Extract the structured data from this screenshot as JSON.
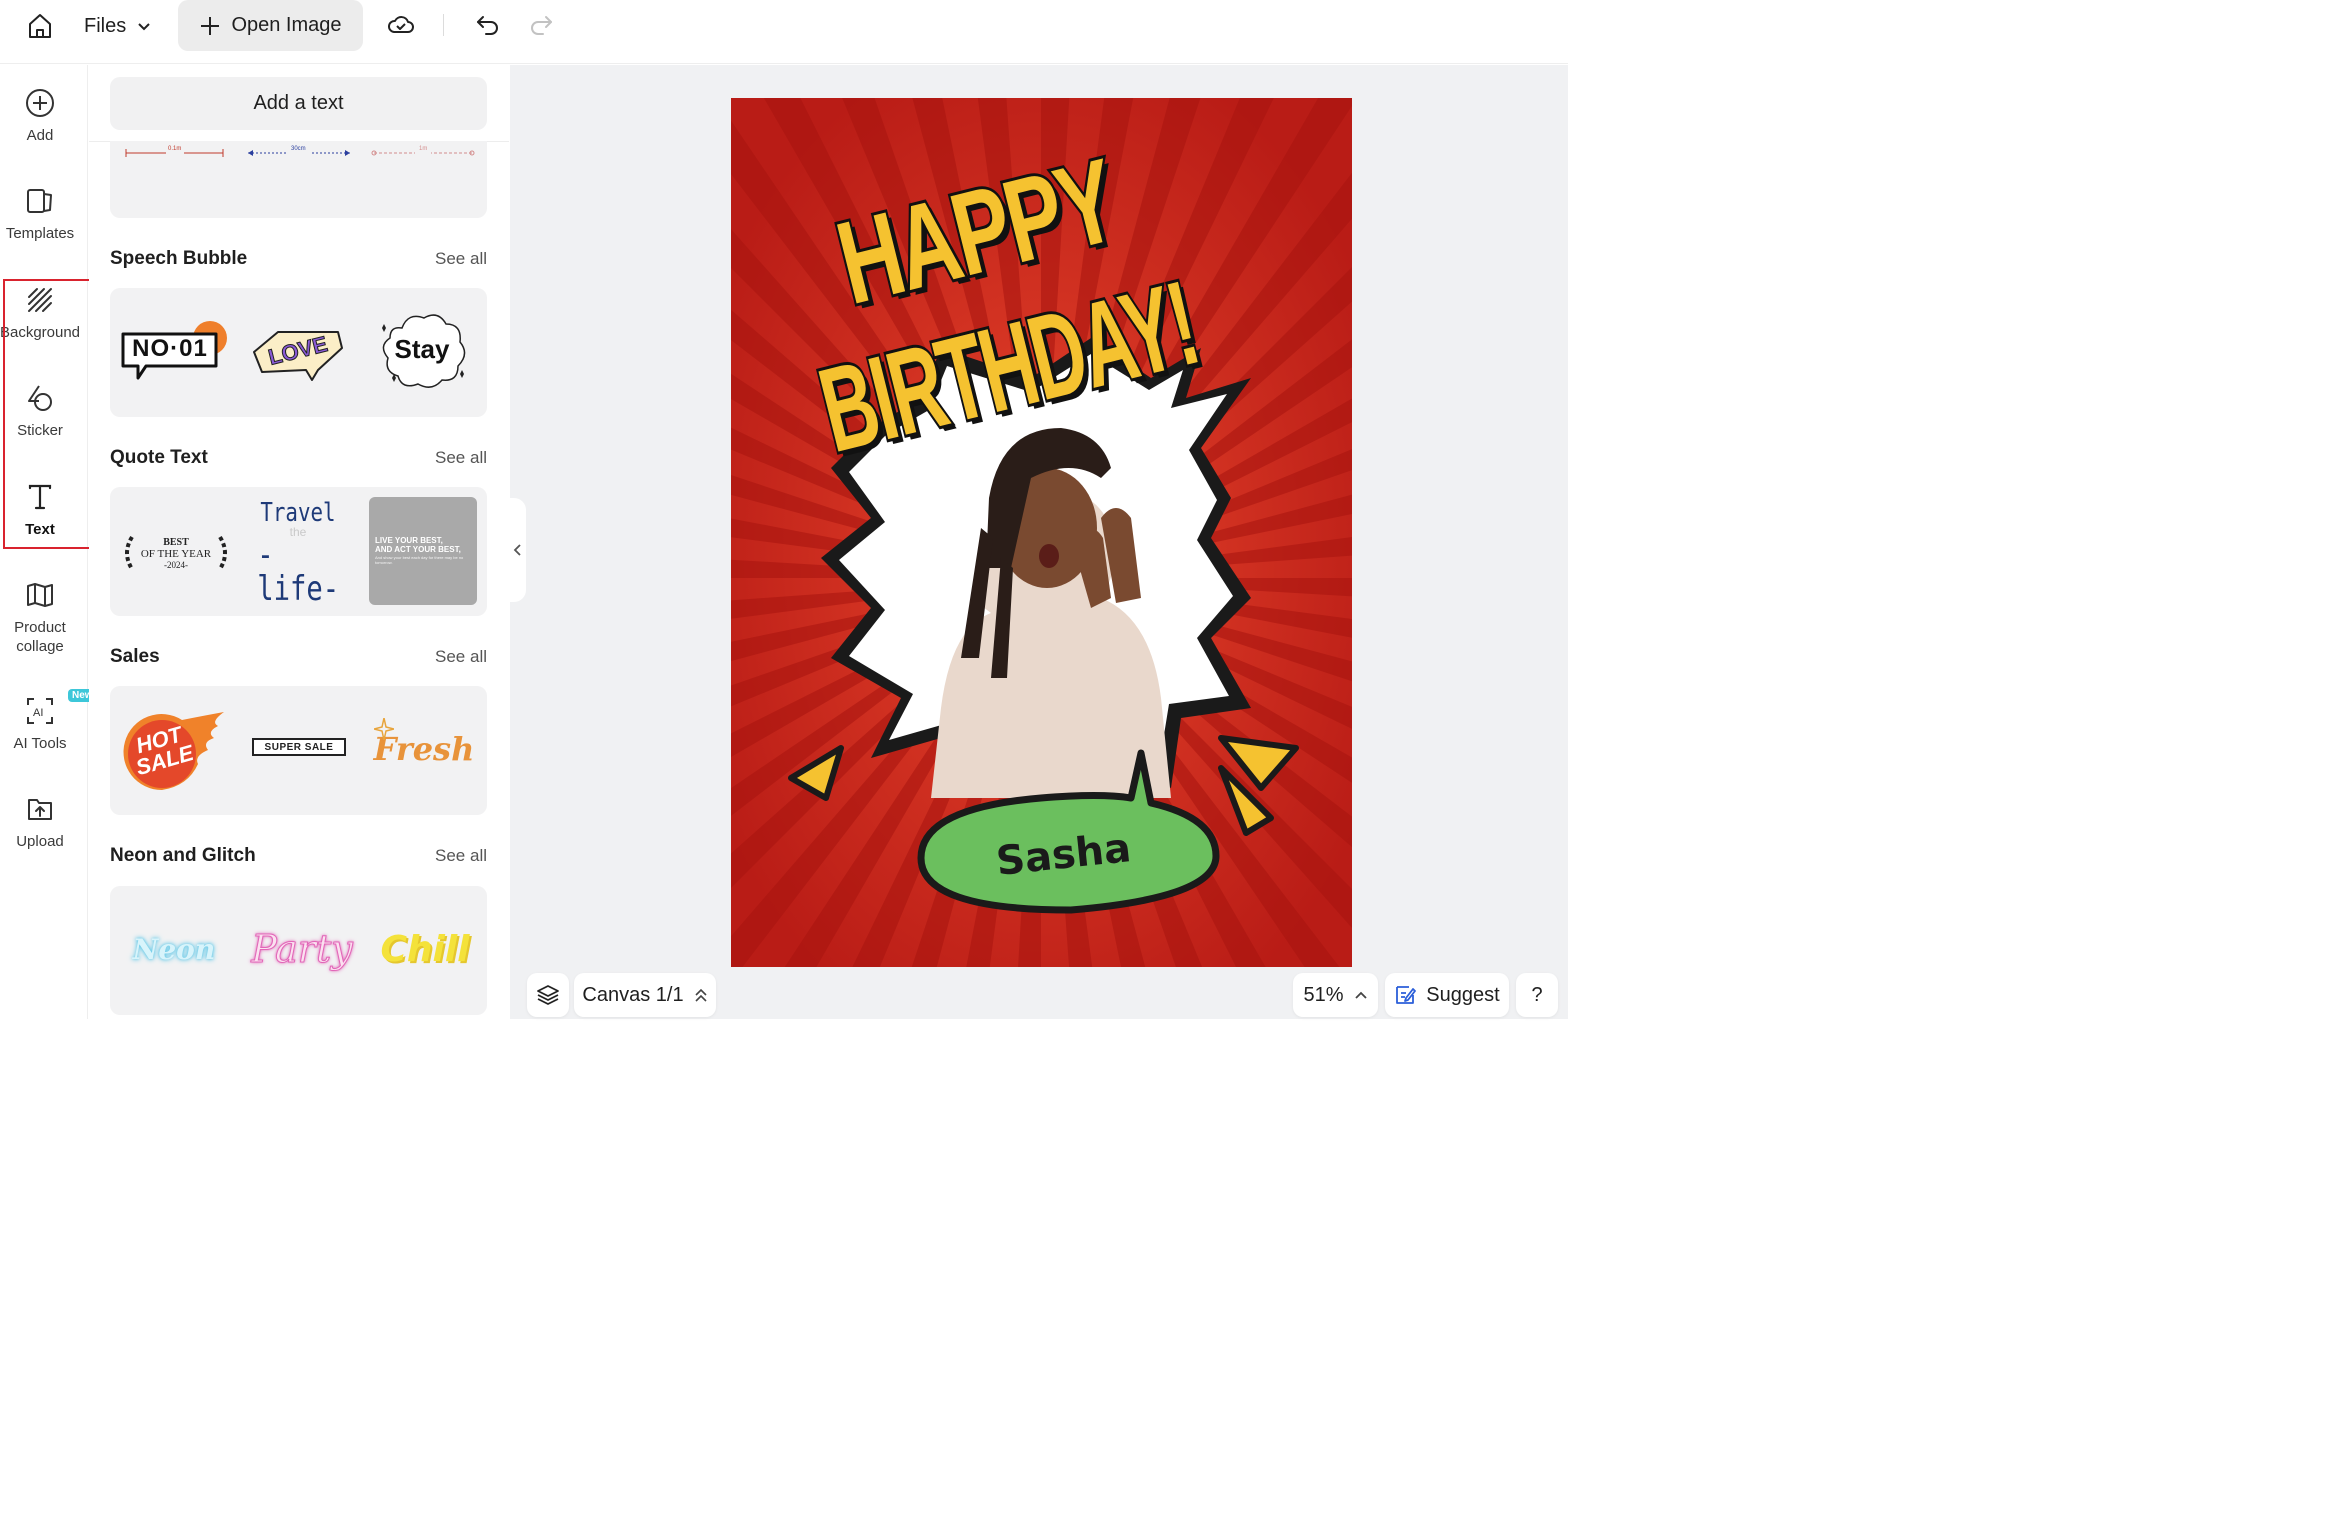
{
  "topbar": {
    "files_label": "Files",
    "open_image_label": "Open Image"
  },
  "rail": {
    "items": [
      {
        "label": "Add",
        "icon": "plus-circle-icon"
      },
      {
        "label": "Templates",
        "icon": "templates-icon"
      },
      {
        "label": "Background",
        "icon": "background-icon"
      },
      {
        "label": "Sticker",
        "icon": "sticker-icon"
      },
      {
        "label": "Text",
        "icon": "text-icon",
        "active": true
      },
      {
        "label": "Product collage",
        "icon": "collage-icon"
      },
      {
        "label": "AI Tools",
        "icon": "ai-tools-icon",
        "badge": "New"
      },
      {
        "label": "Upload",
        "icon": "upload-icon"
      }
    ],
    "highlight_color": "#d9232e"
  },
  "panel": {
    "add_text_label": "Add a text",
    "dimension_samples": [
      "0.1m",
      "30cm",
      "1m"
    ],
    "sections": [
      {
        "title": "Speech Bubble",
        "see_all": "See all",
        "items": [
          "NO·01",
          "LOVE",
          "Stay"
        ]
      },
      {
        "title": "Quote Text",
        "see_all": "See all",
        "items": [
          {
            "line1": "BEST",
            "line2": "OF THE YEAR",
            "line3": "-2024-"
          },
          {
            "line1": "Travel",
            "line2": "the",
            "line3": "-life-"
          },
          {
            "line1": "LIVE YOUR BEST,",
            "line2": "AND ACT YOUR BEST,",
            "line3": "And show your best each day for there may be no tomorrow."
          }
        ]
      },
      {
        "title": "Sales",
        "see_all": "See all",
        "items": [
          "HOT SALE",
          "SUPER SALE",
          "Fresh"
        ]
      },
      {
        "title": "Neon and Glitch",
        "see_all": "See all",
        "items": [
          "Neon",
          "Party",
          "Chill"
        ]
      }
    ]
  },
  "poster": {
    "headline_1": "HAPPY",
    "headline_2": "BIRTHDAY!",
    "name": "Sasha",
    "colors": {
      "red": "#d42a1f",
      "yellow": "#f5c230",
      "green": "#6bbf5e"
    }
  },
  "bottom": {
    "canvas_label": "Canvas 1/1",
    "zoom": "51%",
    "suggest_label": "Suggest",
    "help_label": "?"
  }
}
